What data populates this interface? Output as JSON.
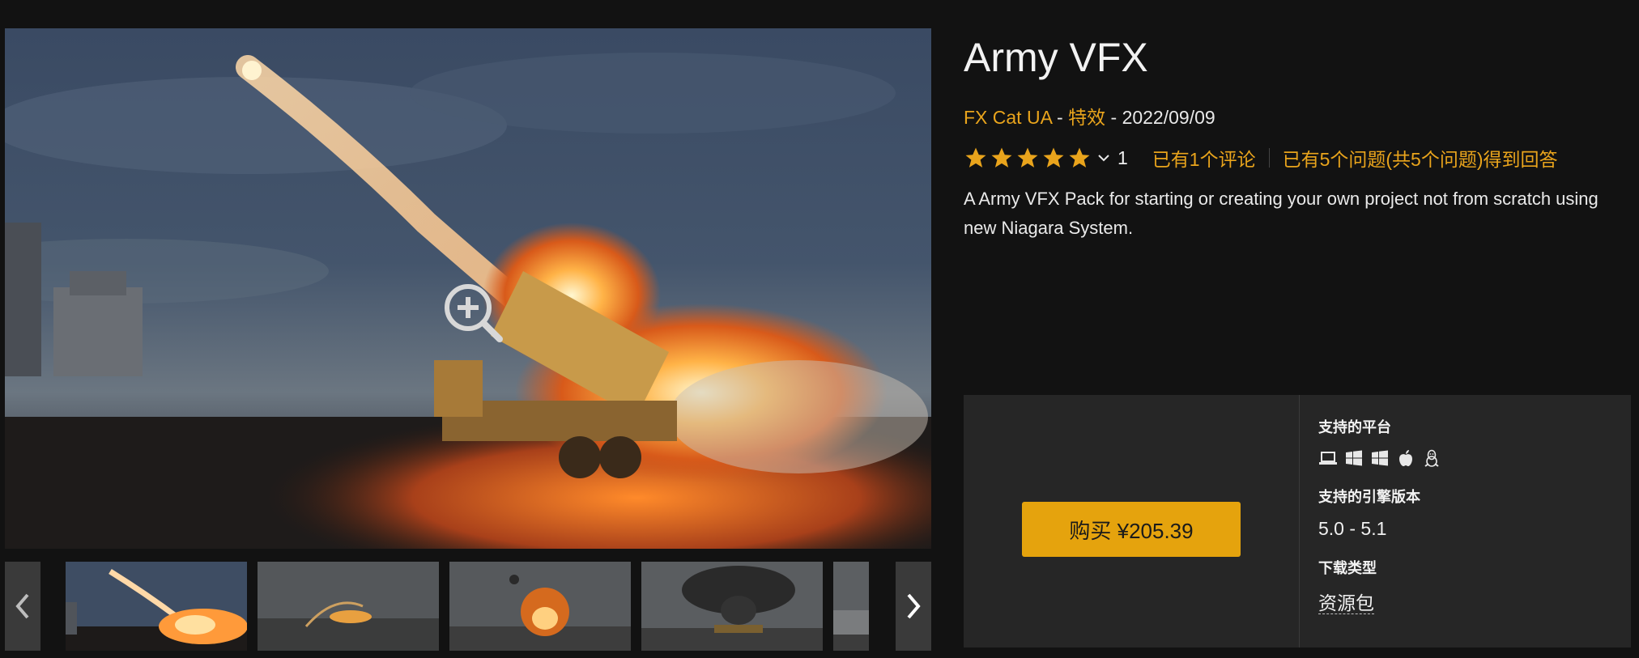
{
  "product": {
    "title": "Army VFX",
    "seller": "FX Cat UA",
    "separator1": " - ",
    "category": "特效",
    "separator2": " - ",
    "date": "2022/09/09",
    "rating_value": 5,
    "rating_count": "1",
    "reviews_link": "已有1个评论",
    "questions_link": "已有5个问题(共5个问题)得到回答",
    "description": "A Army VFX Pack for starting or creating your own project not from scratch using new Niagara System."
  },
  "gallery": {
    "main_image_alt": "Missile launcher firing at dusk",
    "thumbnails": [
      {
        "scene": "missile-launch",
        "selected": true
      },
      {
        "scene": "ground-impact",
        "selected": false
      },
      {
        "scene": "explosion",
        "selected": false
      },
      {
        "scene": "smoke-tank",
        "selected": false
      },
      {
        "scene": "partial",
        "selected": false
      }
    ]
  },
  "purchase": {
    "buy_label": "购买 ¥205.39",
    "platforms_label": "支持的平台",
    "platforms": [
      "laptop-icon",
      "windows-icon",
      "windows-icon",
      "apple-icon",
      "linux-icon"
    ],
    "engine_label": "支持的引擎版本",
    "engine_versions": "5.0 - 5.1",
    "download_label": "下载类型",
    "download_type": "资源包"
  },
  "colors": {
    "background": "#121212",
    "accent": "#e9a41c",
    "button": "#e5a30d",
    "panel": "#262626",
    "star": "#e9a41c"
  }
}
